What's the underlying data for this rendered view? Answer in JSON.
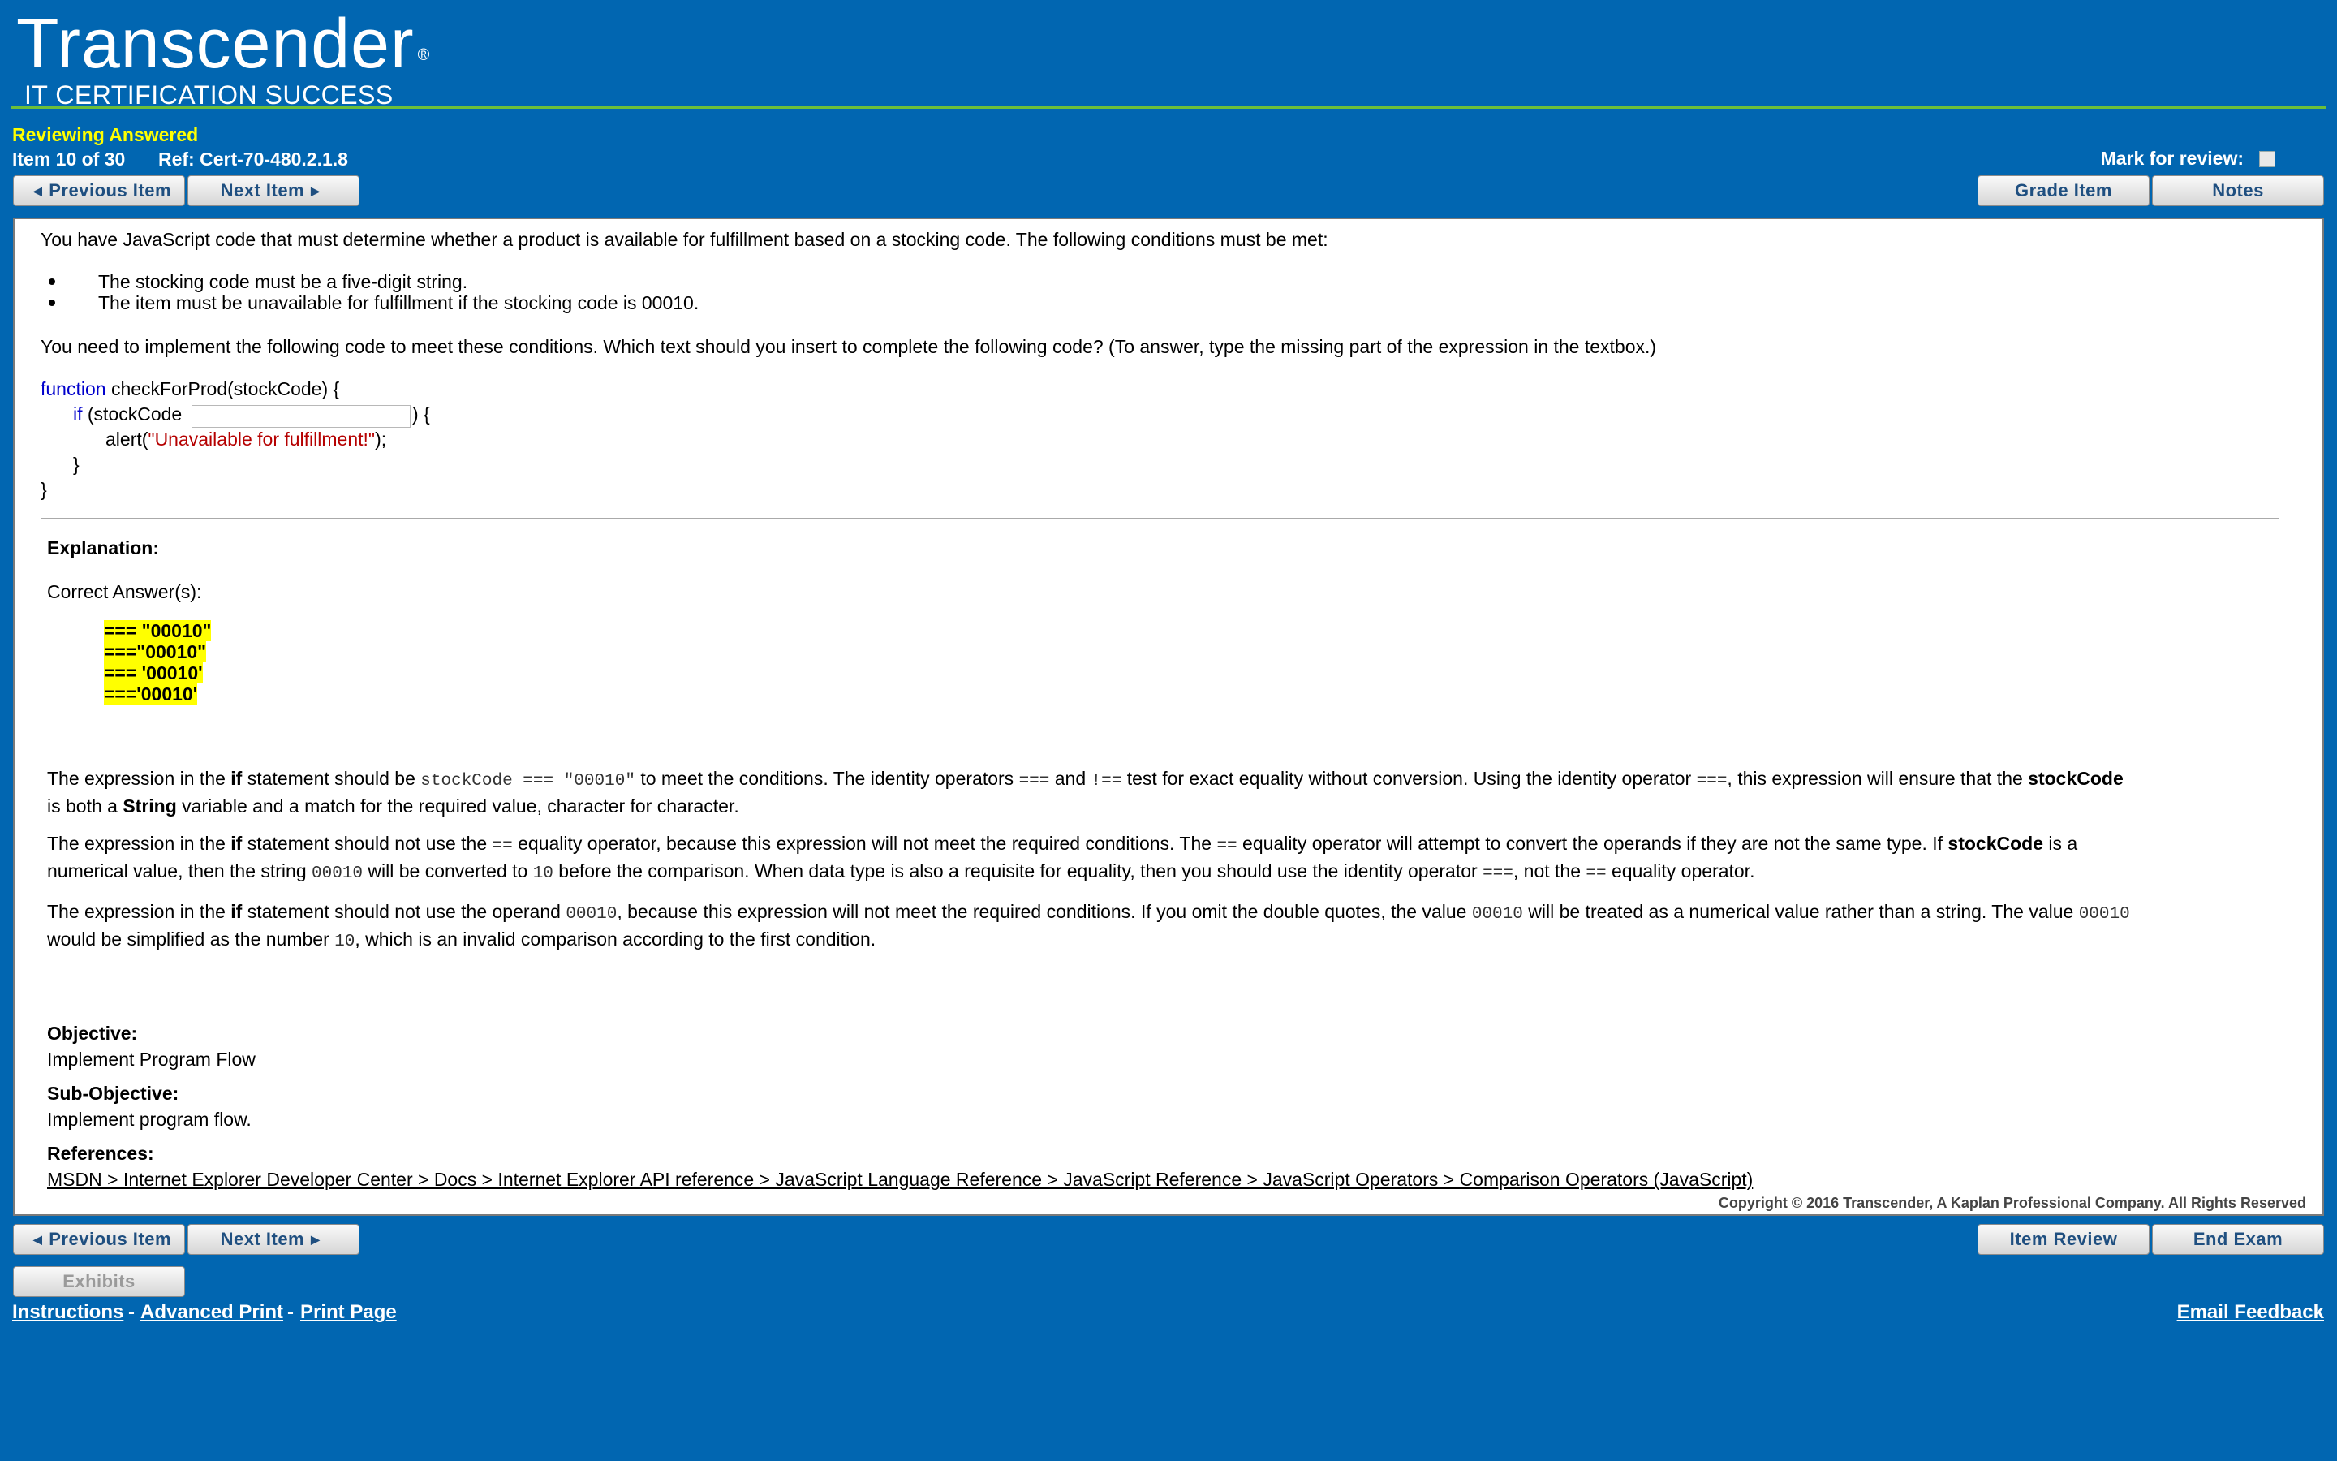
{
  "header": {
    "logo_main": "Transcender",
    "logo_reg": "®",
    "logo_sub": "IT CERTIFICATION SUCCESS",
    "status": "Reviewing Answered",
    "item_counter": "Item 10 of 30",
    "ref": "Ref: Cert-70-480.2.1.8",
    "mark_label": "Mark for review:"
  },
  "buttons": {
    "previous": "Previous Item",
    "next": "Next Item",
    "grade": "Grade Item",
    "notes": "Notes",
    "item_review": "Item Review",
    "end_exam": "End Exam",
    "exhibits": "Exhibits"
  },
  "question": {
    "intro": "You have JavaScript code that must determine whether a product is available for fulfillment based on a stocking code. The following conditions must be met:",
    "bullets": [
      "The stocking code must be a five-digit string.",
      "The item must be unavailable for fulfillment if the stocking code is 00010."
    ],
    "task": "You need to implement the following code to meet these conditions. Which text should you insert to complete the following code? (To answer, type the missing part of the expression in the textbox.)",
    "code": {
      "kw_function": "function",
      "line1_rest": " checkForProd(stockCode) {",
      "kw_if": "if",
      "line2_pre": " (stockCode",
      "line2_post": ") {",
      "line3_pre": "alert(",
      "line3_str": "\"Unavailable for fulfillment!\"",
      "line3_post": ");",
      "line4": "}",
      "line5": "}"
    }
  },
  "explanation": {
    "heading": "Explanation:",
    "correct_label": "Correct Answer(s):",
    "answers": [
      "=== \"00010\"",
      "===\"00010\"",
      "=== '00010'",
      "==='00010'"
    ],
    "p1": {
      "a": "The expression in the ",
      "b": "if",
      "c": " statement should be ",
      "d": "stockCode === \"00010\"",
      "e": " to meet the conditions. The identity operators ",
      "f": "===",
      "g": " and ",
      "h": "!==",
      "i": " test for exact equality without conversion. Using the identity operator ",
      "j": "===",
      "k": ", this expression will ensure that the ",
      "l": "stockCode",
      "m": "is both a ",
      "n": "String",
      "o": " variable and a match for the required value, character for character."
    },
    "p2": {
      "a": "The expression in the ",
      "b": "if",
      "c": " statement should not use the ",
      "d": "==",
      "e": " equality operator, because this expression will not meet the required conditions. The ",
      "f": "==",
      "g": " equality operator will attempt to convert the operands if they are not the same type. If ",
      "h": "stockCode",
      "i": " is a",
      "j": "numerical value, then the string ",
      "k": "00010",
      "l": " will be converted to ",
      "m": "10",
      "n": " before the comparison. When data type is also a requisite for equality, then you should use the identity operator ",
      "o": "===",
      "p": ", not the ",
      "q": "==",
      "r": " equality operator."
    },
    "p3": {
      "a": "The expression in the ",
      "b": "if",
      "c": " statement should not use the operand ",
      "d": "00010",
      "e": ", because this expression will not meet the required conditions. If you omit the double quotes, the value ",
      "f": "00010",
      "g": " will be treated as a numerical value rather than a string. The value ",
      "h": "00010",
      "i": "would be simplified as the number ",
      "j": "10",
      "k": ", which is an invalid comparison according to the first condition."
    },
    "objective_heading": "Objective:",
    "objective": "Implement Program Flow",
    "subobjective_heading": "Sub-Objective:",
    "subobjective": "Implement program flow.",
    "references_heading": "References:",
    "reference_link": "MSDN > Internet Explorer Developer Center > Docs > Internet Explorer API reference > JavaScript Language Reference > JavaScript Reference > JavaScript Operators > Comparison Operators (JavaScript)",
    "copyright": "Copyright © 2016 Transcender, A Kaplan Professional Company. All Rights Reserved"
  },
  "footer": {
    "instructions": "Instructions",
    "advanced_print": "Advanced Print",
    "print_page": "Print Page",
    "separator": "-",
    "email_feedback": "Email Feedback"
  },
  "colors": {
    "background": "#0166b1",
    "accent_green": "#6cbf3a",
    "status_yellow": "#ffff00",
    "highlight": "#ffff00"
  }
}
